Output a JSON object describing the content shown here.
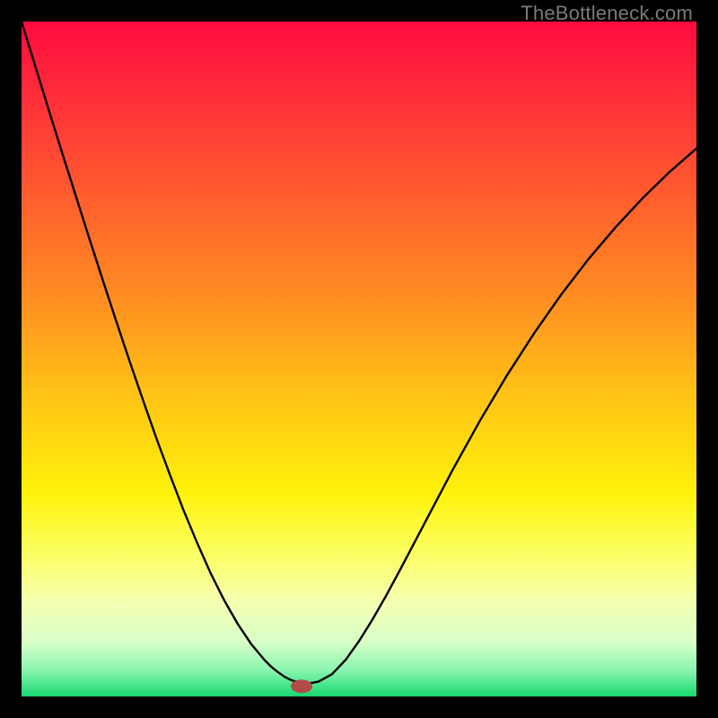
{
  "watermark": {
    "text": "TheBottleneck.com"
  },
  "chart_data": {
    "type": "line",
    "title": "",
    "xlabel": "",
    "ylabel": "",
    "xlim": [
      0,
      100
    ],
    "ylim": [
      0,
      100
    ],
    "grid": false,
    "legend": false,
    "background": {
      "type": "vertical-gradient",
      "stops": [
        {
          "offset": 0.0,
          "color": "#ff0a3f"
        },
        {
          "offset": 0.1,
          "color": "#ff2a3a"
        },
        {
          "offset": 0.25,
          "color": "#ff5a2e"
        },
        {
          "offset": 0.4,
          "color": "#ff8a22"
        },
        {
          "offset": 0.55,
          "color": "#ffc216"
        },
        {
          "offset": 0.7,
          "color": "#fff20a"
        },
        {
          "offset": 0.78,
          "color": "#fcff5a"
        },
        {
          "offset": 0.86,
          "color": "#f4ffb0"
        },
        {
          "offset": 0.92,
          "color": "#d8ffc8"
        },
        {
          "offset": 0.96,
          "color": "#8cf5b0"
        },
        {
          "offset": 1.0,
          "color": "#17d86f"
        }
      ]
    },
    "marker": {
      "x": 41.5,
      "y": 1.5,
      "color": "#b24a4a",
      "rx": 1.6,
      "ry": 1.0
    },
    "series": [
      {
        "name": "curve",
        "color": "#000000",
        "width": 2.4,
        "x": [
          0,
          2,
          4,
          6,
          8,
          10,
          12,
          14,
          16,
          18,
          20,
          22,
          24,
          26,
          28,
          30,
          32,
          34,
          36,
          37,
          38,
          39,
          40,
          41,
          42,
          43,
          44,
          46,
          48,
          50,
          52,
          54,
          56,
          58,
          60,
          64,
          68,
          72,
          76,
          80,
          84,
          88,
          92,
          96,
          100
        ],
        "y": [
          100,
          93.5,
          87.0,
          80.6,
          74.3,
          68.0,
          61.8,
          55.7,
          49.7,
          43.9,
          38.2,
          32.8,
          27.6,
          22.8,
          18.3,
          14.3,
          10.8,
          7.8,
          5.4,
          4.4,
          3.6,
          2.9,
          2.4,
          2.1,
          2.0,
          2.0,
          2.2,
          3.3,
          5.4,
          8.2,
          11.4,
          14.9,
          18.6,
          22.4,
          26.2,
          33.8,
          41.0,
          47.7,
          53.9,
          59.6,
          64.8,
          69.5,
          73.8,
          77.7,
          81.2
        ]
      }
    ]
  }
}
